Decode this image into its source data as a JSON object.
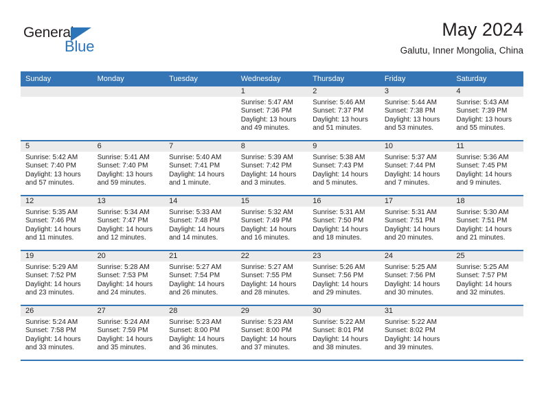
{
  "brand": {
    "name_top": "General",
    "name_bottom": "Blue"
  },
  "header": {
    "title": "May 2024",
    "location": "Galutu, Inner Mongolia, China"
  },
  "colors": {
    "header_blue": "#3575b5",
    "brand_blue": "#2b74b8",
    "daynum_band": "#ebebeb",
    "text": "#231f20"
  },
  "weekday_headers": [
    "Sunday",
    "Monday",
    "Tuesday",
    "Wednesday",
    "Thursday",
    "Friday",
    "Saturday"
  ],
  "labels": {
    "sunrise_prefix": "Sunrise:",
    "sunset_prefix": "Sunset:",
    "daylight_prefix": "Daylight:"
  },
  "weeks": [
    [
      {
        "day": "",
        "sunrise": "",
        "sunset": "",
        "daylight1": "",
        "daylight2": "",
        "empty": true
      },
      {
        "day": "",
        "sunrise": "",
        "sunset": "",
        "daylight1": "",
        "daylight2": "",
        "empty": true
      },
      {
        "day": "",
        "sunrise": "",
        "sunset": "",
        "daylight1": "",
        "daylight2": "",
        "empty": true
      },
      {
        "day": "1",
        "sunrise": "Sunrise: 5:47 AM",
        "sunset": "Sunset: 7:36 PM",
        "daylight1": "Daylight: 13 hours",
        "daylight2": "and 49 minutes.",
        "empty": false
      },
      {
        "day": "2",
        "sunrise": "Sunrise: 5:46 AM",
        "sunset": "Sunset: 7:37 PM",
        "daylight1": "Daylight: 13 hours",
        "daylight2": "and 51 minutes.",
        "empty": false
      },
      {
        "day": "3",
        "sunrise": "Sunrise: 5:44 AM",
        "sunset": "Sunset: 7:38 PM",
        "daylight1": "Daylight: 13 hours",
        "daylight2": "and 53 minutes.",
        "empty": false
      },
      {
        "day": "4",
        "sunrise": "Sunrise: 5:43 AM",
        "sunset": "Sunset: 7:39 PM",
        "daylight1": "Daylight: 13 hours",
        "daylight2": "and 55 minutes.",
        "empty": false
      }
    ],
    [
      {
        "day": "5",
        "sunrise": "Sunrise: 5:42 AM",
        "sunset": "Sunset: 7:40 PM",
        "daylight1": "Daylight: 13 hours",
        "daylight2": "and 57 minutes.",
        "empty": false
      },
      {
        "day": "6",
        "sunrise": "Sunrise: 5:41 AM",
        "sunset": "Sunset: 7:40 PM",
        "daylight1": "Daylight: 13 hours",
        "daylight2": "and 59 minutes.",
        "empty": false
      },
      {
        "day": "7",
        "sunrise": "Sunrise: 5:40 AM",
        "sunset": "Sunset: 7:41 PM",
        "daylight1": "Daylight: 14 hours",
        "daylight2": "and 1 minute.",
        "empty": false
      },
      {
        "day": "8",
        "sunrise": "Sunrise: 5:39 AM",
        "sunset": "Sunset: 7:42 PM",
        "daylight1": "Daylight: 14 hours",
        "daylight2": "and 3 minutes.",
        "empty": false
      },
      {
        "day": "9",
        "sunrise": "Sunrise: 5:38 AM",
        "sunset": "Sunset: 7:43 PM",
        "daylight1": "Daylight: 14 hours",
        "daylight2": "and 5 minutes.",
        "empty": false
      },
      {
        "day": "10",
        "sunrise": "Sunrise: 5:37 AM",
        "sunset": "Sunset: 7:44 PM",
        "daylight1": "Daylight: 14 hours",
        "daylight2": "and 7 minutes.",
        "empty": false
      },
      {
        "day": "11",
        "sunrise": "Sunrise: 5:36 AM",
        "sunset": "Sunset: 7:45 PM",
        "daylight1": "Daylight: 14 hours",
        "daylight2": "and 9 minutes.",
        "empty": false
      }
    ],
    [
      {
        "day": "12",
        "sunrise": "Sunrise: 5:35 AM",
        "sunset": "Sunset: 7:46 PM",
        "daylight1": "Daylight: 14 hours",
        "daylight2": "and 11 minutes.",
        "empty": false
      },
      {
        "day": "13",
        "sunrise": "Sunrise: 5:34 AM",
        "sunset": "Sunset: 7:47 PM",
        "daylight1": "Daylight: 14 hours",
        "daylight2": "and 12 minutes.",
        "empty": false
      },
      {
        "day": "14",
        "sunrise": "Sunrise: 5:33 AM",
        "sunset": "Sunset: 7:48 PM",
        "daylight1": "Daylight: 14 hours",
        "daylight2": "and 14 minutes.",
        "empty": false
      },
      {
        "day": "15",
        "sunrise": "Sunrise: 5:32 AM",
        "sunset": "Sunset: 7:49 PM",
        "daylight1": "Daylight: 14 hours",
        "daylight2": "and 16 minutes.",
        "empty": false
      },
      {
        "day": "16",
        "sunrise": "Sunrise: 5:31 AM",
        "sunset": "Sunset: 7:50 PM",
        "daylight1": "Daylight: 14 hours",
        "daylight2": "and 18 minutes.",
        "empty": false
      },
      {
        "day": "17",
        "sunrise": "Sunrise: 5:31 AM",
        "sunset": "Sunset: 7:51 PM",
        "daylight1": "Daylight: 14 hours",
        "daylight2": "and 20 minutes.",
        "empty": false
      },
      {
        "day": "18",
        "sunrise": "Sunrise: 5:30 AM",
        "sunset": "Sunset: 7:51 PM",
        "daylight1": "Daylight: 14 hours",
        "daylight2": "and 21 minutes.",
        "empty": false
      }
    ],
    [
      {
        "day": "19",
        "sunrise": "Sunrise: 5:29 AM",
        "sunset": "Sunset: 7:52 PM",
        "daylight1": "Daylight: 14 hours",
        "daylight2": "and 23 minutes.",
        "empty": false
      },
      {
        "day": "20",
        "sunrise": "Sunrise: 5:28 AM",
        "sunset": "Sunset: 7:53 PM",
        "daylight1": "Daylight: 14 hours",
        "daylight2": "and 24 minutes.",
        "empty": false
      },
      {
        "day": "21",
        "sunrise": "Sunrise: 5:27 AM",
        "sunset": "Sunset: 7:54 PM",
        "daylight1": "Daylight: 14 hours",
        "daylight2": "and 26 minutes.",
        "empty": false
      },
      {
        "day": "22",
        "sunrise": "Sunrise: 5:27 AM",
        "sunset": "Sunset: 7:55 PM",
        "daylight1": "Daylight: 14 hours",
        "daylight2": "and 28 minutes.",
        "empty": false
      },
      {
        "day": "23",
        "sunrise": "Sunrise: 5:26 AM",
        "sunset": "Sunset: 7:56 PM",
        "daylight1": "Daylight: 14 hours",
        "daylight2": "and 29 minutes.",
        "empty": false
      },
      {
        "day": "24",
        "sunrise": "Sunrise: 5:25 AM",
        "sunset": "Sunset: 7:56 PM",
        "daylight1": "Daylight: 14 hours",
        "daylight2": "and 30 minutes.",
        "empty": false
      },
      {
        "day": "25",
        "sunrise": "Sunrise: 5:25 AM",
        "sunset": "Sunset: 7:57 PM",
        "daylight1": "Daylight: 14 hours",
        "daylight2": "and 32 minutes.",
        "empty": false
      }
    ],
    [
      {
        "day": "26",
        "sunrise": "Sunrise: 5:24 AM",
        "sunset": "Sunset: 7:58 PM",
        "daylight1": "Daylight: 14 hours",
        "daylight2": "and 33 minutes.",
        "empty": false
      },
      {
        "day": "27",
        "sunrise": "Sunrise: 5:24 AM",
        "sunset": "Sunset: 7:59 PM",
        "daylight1": "Daylight: 14 hours",
        "daylight2": "and 35 minutes.",
        "empty": false
      },
      {
        "day": "28",
        "sunrise": "Sunrise: 5:23 AM",
        "sunset": "Sunset: 8:00 PM",
        "daylight1": "Daylight: 14 hours",
        "daylight2": "and 36 minutes.",
        "empty": false
      },
      {
        "day": "29",
        "sunrise": "Sunrise: 5:23 AM",
        "sunset": "Sunset: 8:00 PM",
        "daylight1": "Daylight: 14 hours",
        "daylight2": "and 37 minutes.",
        "empty": false
      },
      {
        "day": "30",
        "sunrise": "Sunrise: 5:22 AM",
        "sunset": "Sunset: 8:01 PM",
        "daylight1": "Daylight: 14 hours",
        "daylight2": "and 38 minutes.",
        "empty": false
      },
      {
        "day": "31",
        "sunrise": "Sunrise: 5:22 AM",
        "sunset": "Sunset: 8:02 PM",
        "daylight1": "Daylight: 14 hours",
        "daylight2": "and 39 minutes.",
        "empty": false
      },
      {
        "day": "",
        "sunrise": "",
        "sunset": "",
        "daylight1": "",
        "daylight2": "",
        "empty": true
      }
    ]
  ]
}
